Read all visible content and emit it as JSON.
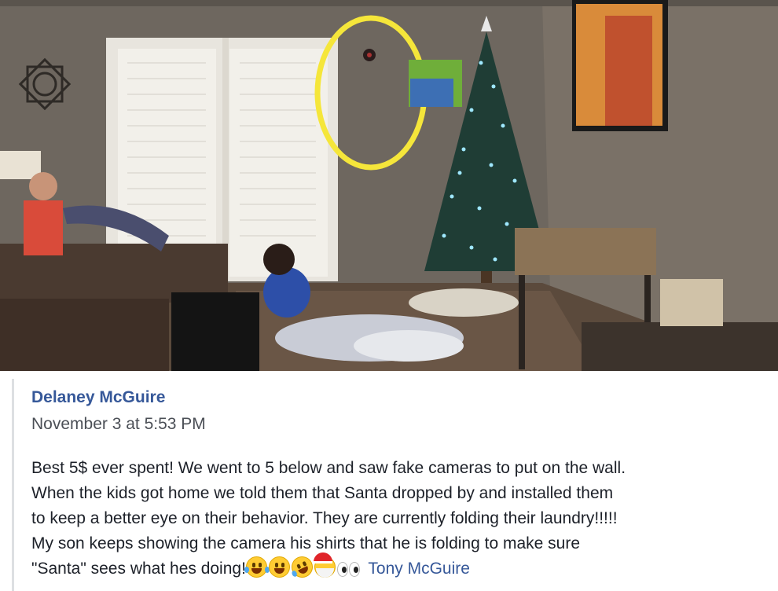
{
  "post": {
    "author": "Delaney McGuire",
    "timestamp": "November 3 at 5:53 PM",
    "lines": [
      "Best 5$ ever spent! We went to 5 below and saw fake cameras to put on the wall.",
      "When the kids got home we told them that Santa dropped by and installed them",
      "to keep a better eye on their behavior. They are currently folding their laundry!!!!!",
      "My son keeps showing the camera his shirts that he is folding to make sure"
    ],
    "last_line_text": "\"Santa\" sees what hes doing!",
    "tagged_user": "Tony McGuire",
    "emojis": [
      "tears-of-joy-emoji",
      "grinning-emoji",
      "rolling-laughing-emoji",
      "santa-emoji",
      "eyes-emoji"
    ]
  },
  "colors": {
    "link": "#365899",
    "text": "#1d2129",
    "meta": "#4b4f56",
    "highlight_circle": "#f5e63a"
  }
}
